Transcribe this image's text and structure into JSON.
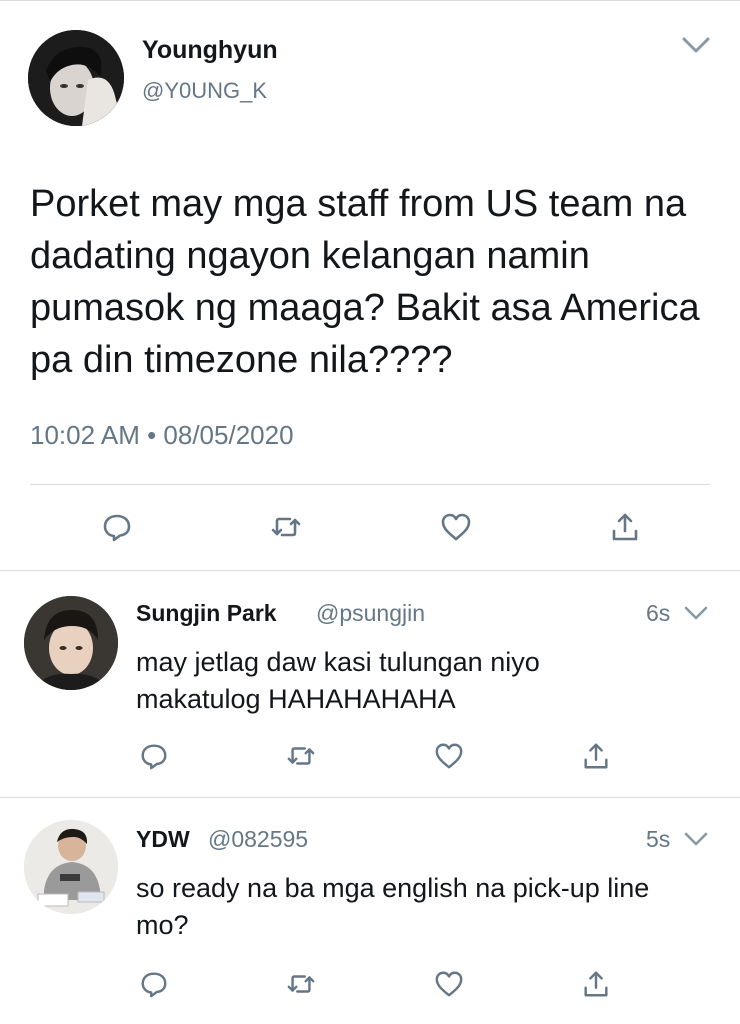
{
  "main_tweet": {
    "name": "Younghyun",
    "handle": "@Y0UNG_K",
    "text": "Porket may mga staff from US team na dadating ngayon kelangan namin pumasok ng maaga? Bakit asa America pa din timezone nila????",
    "timestamp": "10:02 AM • 08/05/2020"
  },
  "replies": [
    {
      "name": "Sungjin Park",
      "handle": "@psungjin",
      "time": "6s",
      "text": "may jetlag daw kasi tulungan niyo makatulog HAHAHAHAHA"
    },
    {
      "name": "YDW",
      "handle": "@082595",
      "time": "5s",
      "text": "so ready na ba mga english na pick-up line mo?"
    }
  ],
  "icons": {
    "reply": "reply-icon",
    "retweet": "retweet-icon",
    "like": "heart-icon",
    "share": "share-icon",
    "more": "chevron-down-icon"
  },
  "colors": {
    "text": "#14171a",
    "muted": "#657786",
    "divider": "#d9dde1"
  }
}
